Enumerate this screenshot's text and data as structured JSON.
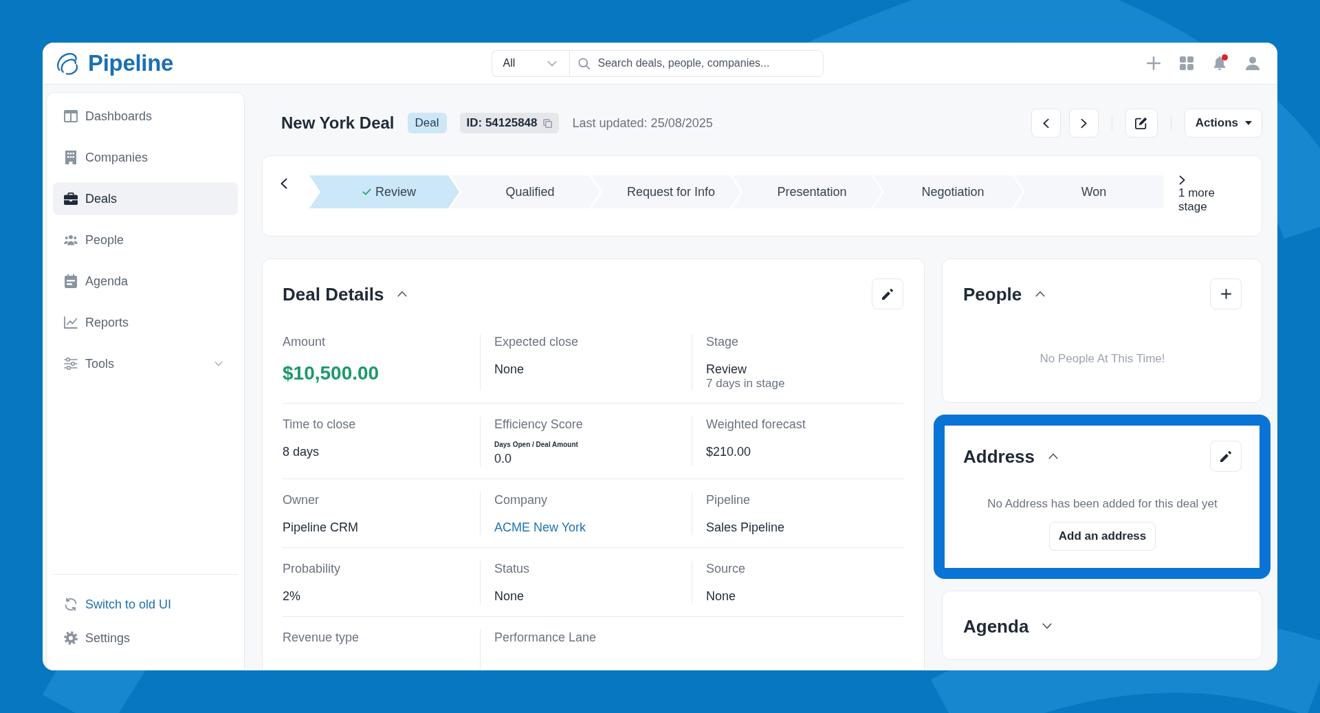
{
  "app": {
    "logo_text": "Pipeline"
  },
  "header": {
    "search_scope": "All",
    "search": {
      "placeholder": "Search deals, people, companies..."
    },
    "unread": true
  },
  "sidebar": {
    "items": [
      {
        "label": "Dashboards",
        "kind": "link",
        "selected": false
      },
      {
        "label": "Companies",
        "kind": "link",
        "selected": false
      },
      {
        "label": "Deals",
        "kind": "link",
        "selected": true
      },
      {
        "label": "People",
        "kind": "link",
        "selected": false
      },
      {
        "label": "Agenda",
        "kind": "link",
        "selected": false
      },
      {
        "label": "Reports",
        "kind": "link",
        "selected": false
      },
      {
        "label": "Tools",
        "kind": "group",
        "selected": false
      }
    ],
    "footer_items": [
      {
        "label": "Switch to old UI",
        "kind": "link"
      },
      {
        "label": "Settings",
        "kind": "item"
      }
    ]
  },
  "deal_header": {
    "title": "New York Deal",
    "type_badge": "Deal",
    "id": "ID: 54125848",
    "last_updated": "Last updated: 25/08/2025",
    "actions_label": "Actions"
  },
  "stages": {
    "items": [
      {
        "label": "Review",
        "selected": true,
        "completed": true
      },
      {
        "label": "Qualified",
        "selected": false,
        "completed": false
      },
      {
        "label": "Request for Info",
        "selected": false,
        "completed": false
      },
      {
        "label": "Presentation",
        "selected": false,
        "completed": false
      },
      {
        "label": "Negotiation",
        "selected": false,
        "completed": false
      },
      {
        "label": "Won",
        "selected": false,
        "completed": false
      }
    ],
    "more": "1 more stage"
  },
  "deal_details": {
    "title": "Deal Details",
    "expanded": true,
    "fields": [
      {
        "label": "Amount",
        "kind": "amount",
        "value": "$10,500.00"
      },
      {
        "label": "Expected close",
        "kind": "text",
        "value": "None"
      },
      {
        "label": "Stage",
        "kind": "text",
        "value": "Review",
        "note": "7 days in stage"
      },
      {
        "label": "Time to close",
        "kind": "text",
        "value": "8 days"
      },
      {
        "label": "Efficiency Score",
        "kind": "text",
        "caption": "Days Open / Deal Amount",
        "value": "0.0"
      },
      {
        "label": "Weighted forecast",
        "kind": "text",
        "value": "$210.00"
      },
      {
        "label": "Owner",
        "kind": "text",
        "value": "Pipeline CRM"
      },
      {
        "label": "Company",
        "kind": "link",
        "value": "ACME New York"
      },
      {
        "label": "Pipeline",
        "kind": "text",
        "value": "Sales Pipeline"
      },
      {
        "label": "Probability",
        "kind": "text",
        "value": "2%"
      },
      {
        "label": "Status",
        "kind": "text",
        "value": "None"
      },
      {
        "label": "Source",
        "kind": "text",
        "value": "None"
      },
      {
        "label": "Revenue type"
      },
      {
        "label": "Performance Lane"
      }
    ]
  },
  "people": {
    "title": "People",
    "expanded": true,
    "highlighted": false,
    "empty_text": "No People At This Time!"
  },
  "address": {
    "title": "Address",
    "expanded": true,
    "highlighted": true,
    "empty_text": "No Address has been added for this deal yet",
    "action_label": "Add an address"
  },
  "agenda": {
    "title": "Agenda",
    "expanded": false,
    "highlighted": false
  }
}
